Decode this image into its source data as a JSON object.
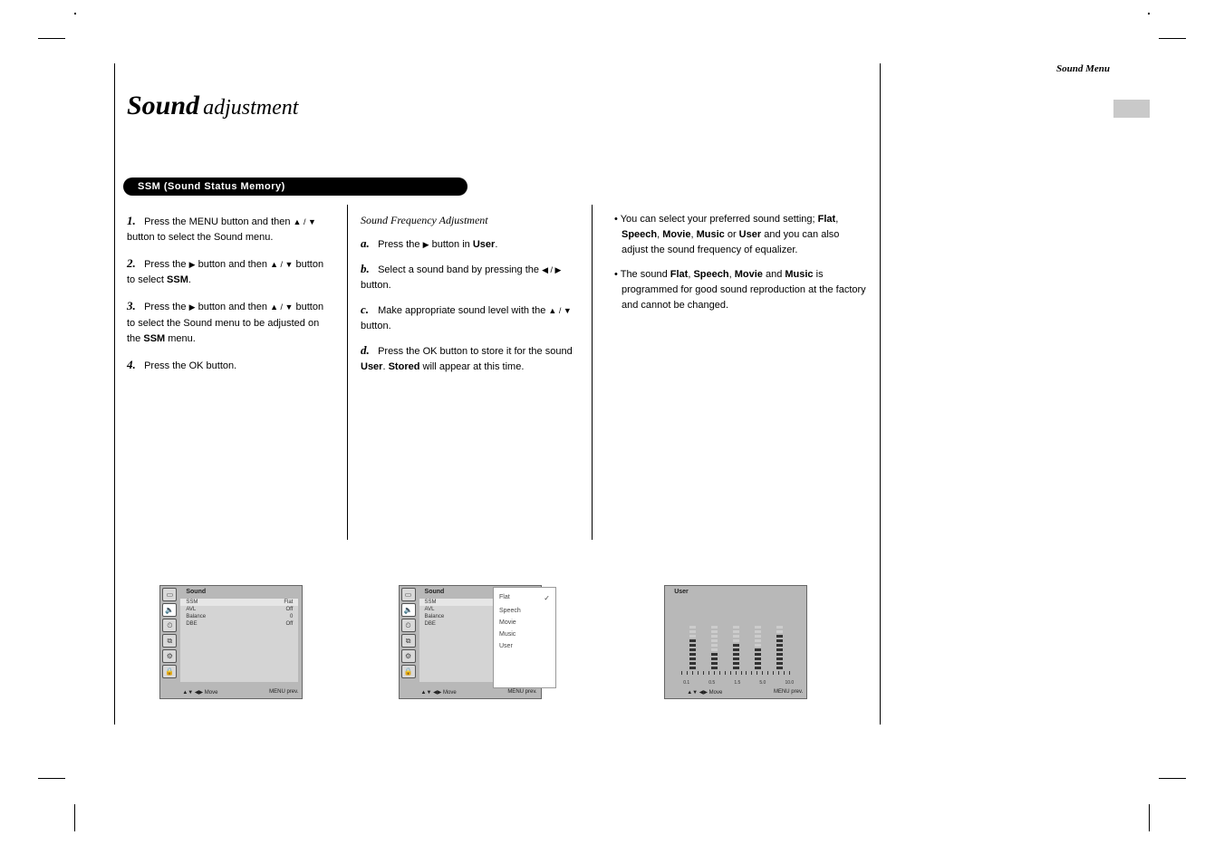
{
  "page": {
    "section_title": "Sound Menu",
    "heading_prefix": "Sound",
    "heading_suffix": " adjustment"
  },
  "pill": "SSM (Sound Status Memory)",
  "col1": {
    "s1a": "Press the MENU button and then ",
    "s1b": " button to select the Sound menu.",
    "s2a": "Press the ",
    "s2b": " button and then ",
    "s2c": " button to select ",
    "s2_bold": "SSM",
    "s3a": "Press the ",
    "s3b": " button and then ",
    "s3c": " button to select the Sound menu to be adjusted on the ",
    "s3_bold": "SSM",
    "s3d": " menu.",
    "s4": "Press the OK button."
  },
  "col2": {
    "user_title": "Sound Frequency Adjustment",
    "ua_a": "Press the ",
    "ua_b": " button in ",
    "ua_bold": "User",
    "ub_a": "Select a sound band by pressing the ",
    "ub_b": " button.",
    "uc_a": "Make appropriate sound level with the ",
    "uc_b": " button.",
    "ud_a": "Press the OK button to store it for the sound ",
    "ud_bold": "User",
    "ue_bold": "Stored",
    "ue_b": " will appear at this time."
  },
  "col3": {
    "bullet_a": "You can select your preferred sound setting; ",
    "b_flat": "Flat",
    "b_speech": "Speech",
    "b_movie": "Movie",
    "b_music": "Music",
    "b_user": "User",
    "bullet_a2": " and you can also adjust the sound frequency of equalizer.",
    "bullet_b1": "The sound ",
    "bullet_b2": " is programmed for good sound reproduction at the factory and cannot be changed."
  },
  "osd": {
    "title": "Sound",
    "items": [
      {
        "label": "SSM",
        "value": "Flat"
      },
      {
        "label": "AVL",
        "value": "Off"
      },
      {
        "label": "Balance",
        "value": "0"
      },
      {
        "label": "DBE",
        "value": "Off"
      }
    ],
    "foot_left": "Move",
    "foot_right": "MENU   prev."
  },
  "submenu": {
    "items": [
      "Flat",
      "Speech",
      "Movie",
      "Music",
      "User"
    ],
    "check_index": 0
  },
  "eq": {
    "title": "User",
    "bands": [
      "0.1",
      "0.5",
      "1.5",
      "5.0",
      "10.0"
    ],
    "levels": [
      7,
      4,
      6,
      5,
      8
    ],
    "max": 10,
    "foot_left": "Move",
    "foot_right": "MENU   prev."
  },
  "symbols": {
    "up": "▲",
    "down": "▼",
    "left": "◀",
    "right": "▶",
    "updown": "▲ / ▼",
    "leftright": "◀ / ▶",
    "check": "✓"
  },
  "sidebar_icons": [
    "▭",
    "🔈",
    "⌚",
    "⧉",
    "⚙",
    "🔒"
  ]
}
